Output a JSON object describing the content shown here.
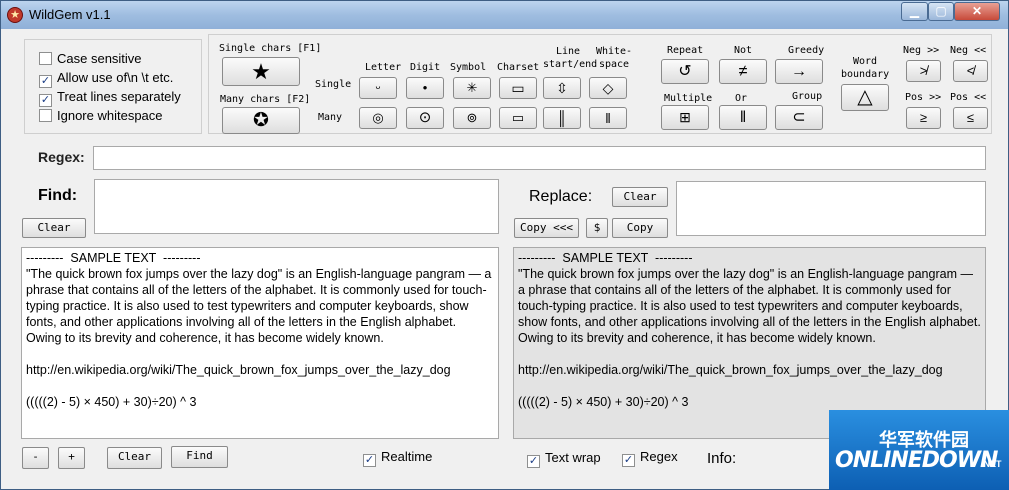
{
  "window": {
    "title": "WildGem v1.1",
    "min": "▁",
    "max": "▢",
    "close": "✕"
  },
  "options": [
    {
      "label": "Case sensitive",
      "checked": false,
      "mark": ""
    },
    {
      "label": "Allow use of\\n \\t etc.",
      "checked": true,
      "mark": "✓"
    },
    {
      "label": "Treat lines separately",
      "checked": true,
      "mark": "✓"
    },
    {
      "label": "Ignore whitespace",
      "checked": false,
      "mark": ""
    }
  ],
  "chars": {
    "single_header": "Single chars [F1]",
    "many_header": "Many chars [F2]",
    "single_glyph": "★",
    "many_glyph": "✪",
    "row_single": "Single",
    "row_many": "Many",
    "cols": [
      {
        "label": "Letter",
        "single": "ᵕ",
        "many": "◎"
      },
      {
        "label": "Digit",
        "single": "•",
        "many": "⊙"
      },
      {
        "label": "Symbol",
        "single": "✳",
        "many": "⊚"
      },
      {
        "label": "Charset",
        "single": "▭",
        "many": "▭"
      },
      {
        "label": "Line start/end",
        "single": "⇳",
        "many": "║"
      },
      {
        "label": "White-space",
        "single": "◇",
        "many": "‖"
      }
    ]
  },
  "ops": [
    {
      "label": "Repeat",
      "glyph": "↺"
    },
    {
      "label": "Not",
      "glyph": "≠"
    },
    {
      "label": "Greedy",
      "glyph": "→"
    },
    {
      "label": "Multiple",
      "glyph": "⊞"
    },
    {
      "label": "Or",
      "glyph": "‖"
    },
    {
      "label": "Group",
      "glyph": "⊂"
    }
  ],
  "word_boundary": {
    "label1": "Word",
    "label2": "boundary",
    "glyph": "△"
  },
  "look": [
    {
      "label": "Neg >>",
      "glyph": "≯"
    },
    {
      "label": "Neg <<",
      "glyph": "≮"
    },
    {
      "label": "Pos >>",
      "glyph": "≥"
    },
    {
      "label": "Pos <<",
      "glyph": "≤"
    }
  ],
  "regex": {
    "label": "Regex:",
    "value": ""
  },
  "find": {
    "label": "Find:",
    "value": "",
    "clear": "Clear"
  },
  "replace": {
    "label": "Replace:",
    "value": "",
    "clear": "Clear",
    "copy_back": "Copy <<<",
    "dollar": "$",
    "copy": "Copy"
  },
  "sample_text": "---------  SAMPLE TEXT  ---------\n\"The quick brown fox jumps over the lazy dog\" is an English-language pangram — a phrase that contains all of the letters of the alphabet. It is commonly used for touch-typing practice. It is also used to test typewriters and computer keyboards, show fonts, and other applications involving all of the letters in the English alphabet. Owing to its brevity and coherence, it has become widely known.\n\nhttp://en.wikipedia.org/wiki/The_quick_brown_fox_jumps_over_the_lazy_dog\n\n(((((2) - 5) × 450) + 30)÷20) ^ 3",
  "bottom": {
    "minus": "-",
    "plus": "+",
    "clear": "Clear",
    "find": "Find",
    "realtime": "Realtime",
    "textwrap": "Text wrap",
    "regex": "Regex",
    "info": "Info:"
  },
  "watermark": {
    "cn": "华军软件园",
    "en": "ONLINEDOWN",
    "net": ".NET"
  }
}
